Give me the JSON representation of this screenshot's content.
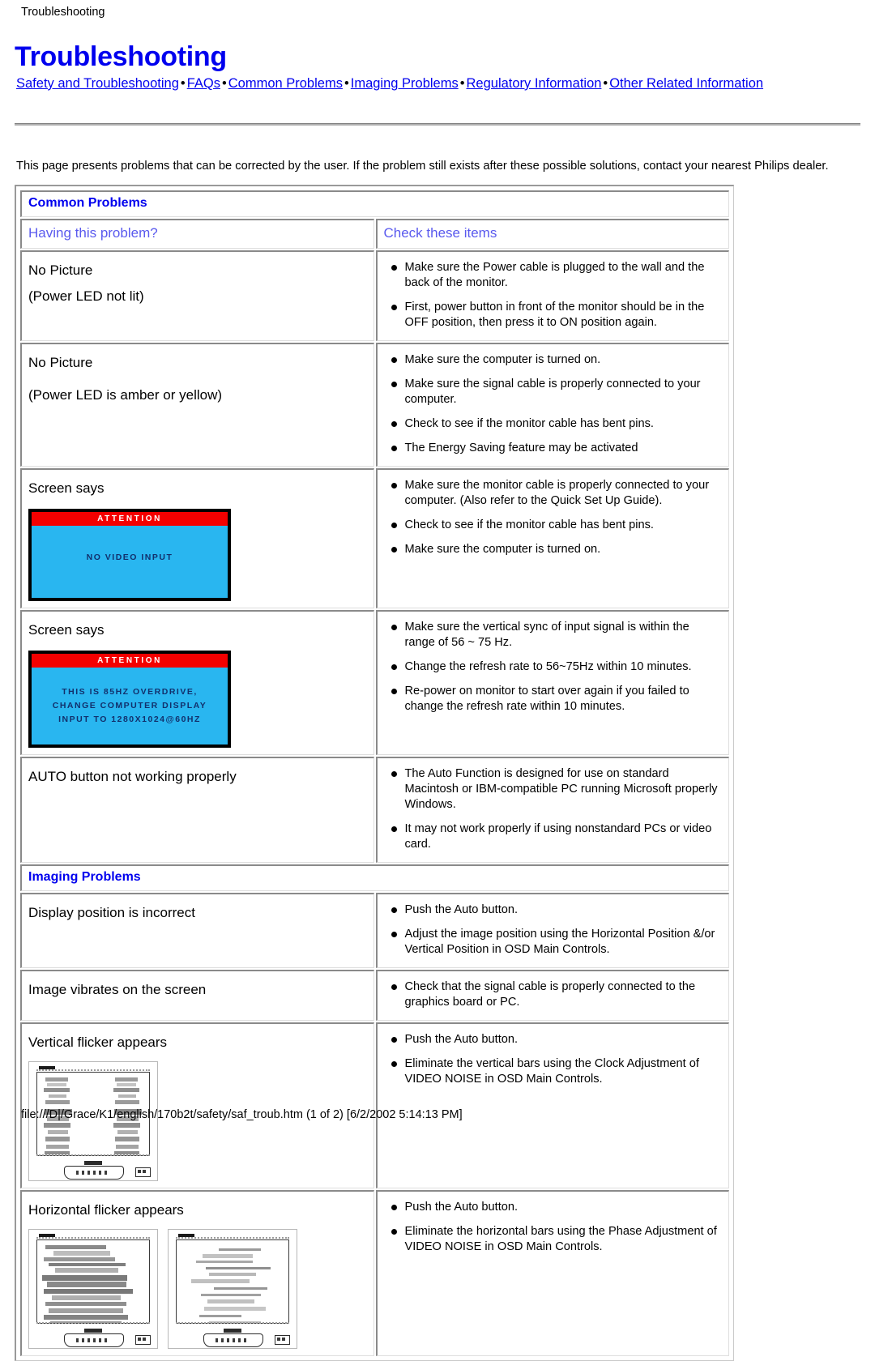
{
  "breadcrumb": "Troubleshooting",
  "page_title": "Troubleshooting",
  "nav": {
    "separator": "•",
    "links": [
      "Safety and Troubleshooting",
      "FAQs",
      "Common Problems",
      "Imaging Problems",
      "Regulatory Information",
      "Other Related Information"
    ]
  },
  "intro": "This page presents problems that can be corrected by the user. If the problem still exists after these possible solutions, contact your nearest Philips dealer.",
  "table": {
    "section_common": "Common Problems",
    "col_head_left": "Having this problem?",
    "col_head_right": "Check these items",
    "section_imaging": "Imaging Problems",
    "rows": [
      {
        "problem_line1": "No Picture",
        "problem_line2": "(Power LED not lit)",
        "checks": [
          "Make sure the Power cable is plugged to the wall and the back of the monitor.",
          "First, power button in front of the monitor should be in the OFF position, then press it to ON position again."
        ]
      },
      {
        "problem_line1": "No Picture",
        "problem_line2": "(Power LED is amber or yellow)",
        "checks": [
          "Make sure the computer is turned on.",
          "Make sure the signal cable is properly connected to your computer.",
          "Check to see if the monitor cable has bent pins.",
          "The Energy Saving feature may be activated"
        ]
      },
      {
        "problem_line1": "Screen says",
        "osd": {
          "title": "ATTENTION",
          "lines": [
            "NO VIDEO INPUT"
          ]
        },
        "checks": [
          "Make sure the monitor cable is properly connected to your computer. (Also refer to the Quick Set Up Guide).",
          "Check to see if the monitor cable has bent pins.",
          "Make sure the computer is turned on."
        ]
      },
      {
        "problem_line1": "Screen says",
        "osd": {
          "title": "ATTENTION",
          "lines": [
            "THIS IS 85HZ OVERDRIVE,",
            "CHANGE COMPUTER DISPLAY",
            "INPUT TO 1280X1024@60HZ"
          ]
        },
        "checks": [
          "Make sure the vertical sync of input signal is within the range of 56 ~ 75 Hz.",
          "Change the refresh rate to 56~75Hz within 10 minutes.",
          "Re-power on monitor to start over again if you failed to change the refresh rate within 10 minutes."
        ]
      },
      {
        "problem_line1": "AUTO button not working properly",
        "checks": [
          "The Auto Function is designed for use on standard Macintosh or IBM-compatible PC running Microsoft properly Windows.",
          "It may not work properly if using nonstandard PCs or video card."
        ]
      }
    ],
    "imaging_rows": [
      {
        "problem_line1": "Display position is incorrect",
        "checks": [
          "Push the Auto button.",
          "Adjust the image position using the Horizontal Position &/or Vertical Position in OSD Main Controls."
        ]
      },
      {
        "problem_line1": "Image vibrates on the screen",
        "checks": [
          "Check that the signal cable is properly connected to the graphics board or PC."
        ]
      },
      {
        "problem_line1": "Vertical flicker appears",
        "monitors": 1,
        "checks": [
          "Push the Auto button.",
          "Eliminate the vertical bars using the Clock Adjustment of VIDEO NOISE in OSD Main Controls."
        ]
      },
      {
        "problem_line1": "Horizontal flicker appears",
        "monitors": 2,
        "checks": [
          "Push the Auto button.",
          "Eliminate the horizontal bars using the Phase Adjustment of VIDEO NOISE in OSD Main Controls."
        ]
      }
    ]
  },
  "footer": "file:///D|/Grace/K1/english/170b2t/safety/saf_troub.htm (1 of 2) [6/2/2002 5:14:13 PM]",
  "colors": {
    "link": "#0000ee",
    "heading": "#0000ee",
    "col_head": "#5a5aee",
    "osd_bar": "#f40000",
    "osd_bg": "#29b6f0",
    "osd_text": "#12306c"
  }
}
